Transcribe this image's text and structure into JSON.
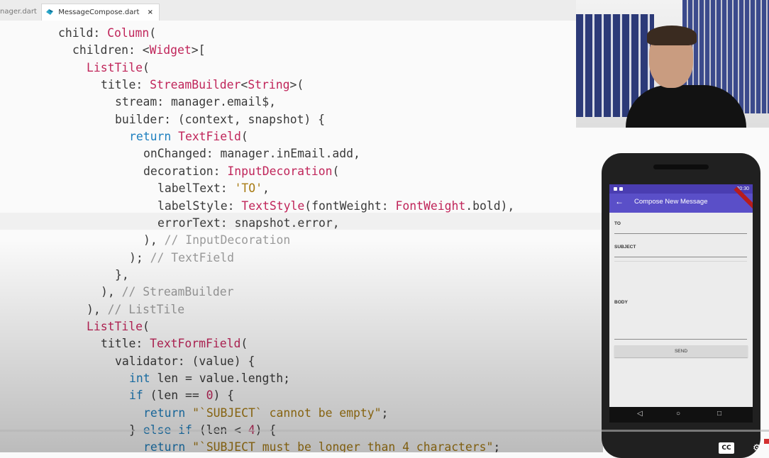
{
  "tabs": [
    {
      "label": "nager.dart",
      "active": false
    },
    {
      "label": "MessageCompose.dart",
      "active": true,
      "close": "×"
    }
  ],
  "code_lines": [
    {
      "indent": 0,
      "parts": [
        {
          "t": "child: ",
          "c": ""
        },
        {
          "t": "Column",
          "c": "t"
        },
        {
          "t": "(",
          "c": ""
        }
      ]
    },
    {
      "indent": 1,
      "parts": [
        {
          "t": "children: ",
          "c": ""
        },
        {
          "t": "<",
          "c": ""
        },
        {
          "t": "Widget",
          "c": "t"
        },
        {
          "t": ">[",
          "c": ""
        }
      ]
    },
    {
      "indent": 2,
      "parts": [
        {
          "t": "ListTile",
          "c": "t"
        },
        {
          "t": "(",
          "c": ""
        }
      ]
    },
    {
      "indent": 3,
      "parts": [
        {
          "t": "title: ",
          "c": ""
        },
        {
          "t": "StreamBuilder",
          "c": "t"
        },
        {
          "t": "<",
          "c": ""
        },
        {
          "t": "String",
          "c": "t"
        },
        {
          "t": ">(",
          "c": ""
        }
      ]
    },
    {
      "indent": 4,
      "parts": [
        {
          "t": "stream: manager.email$,",
          "c": ""
        }
      ]
    },
    {
      "indent": 4,
      "parts": [
        {
          "t": "builder: (context, snapshot) {",
          "c": ""
        }
      ]
    },
    {
      "indent": 5,
      "parts": [
        {
          "t": "return ",
          "c": "k"
        },
        {
          "t": "TextField",
          "c": "t"
        },
        {
          "t": "(",
          "c": ""
        }
      ]
    },
    {
      "indent": 6,
      "parts": [
        {
          "t": "onChanged: manager.inEmail.add,",
          "c": ""
        }
      ]
    },
    {
      "indent": 6,
      "parts": [
        {
          "t": "decoration: ",
          "c": ""
        },
        {
          "t": "InputDecoration",
          "c": "t"
        },
        {
          "t": "(",
          "c": ""
        }
      ]
    },
    {
      "indent": 7,
      "parts": [
        {
          "t": "labelText: ",
          "c": ""
        },
        {
          "t": "'TO'",
          "c": "s"
        },
        {
          "t": ",",
          "c": ""
        }
      ]
    },
    {
      "indent": 7,
      "parts": [
        {
          "t": "labelStyle: ",
          "c": ""
        },
        {
          "t": "TextStyle",
          "c": "t"
        },
        {
          "t": "(fontWeight: ",
          "c": ""
        },
        {
          "t": "FontWeight",
          "c": "t"
        },
        {
          "t": ".bold),",
          "c": ""
        }
      ]
    },
    {
      "indent": 7,
      "parts": [
        {
          "t": "errorText: snapshot.error,",
          "c": ""
        }
      ]
    },
    {
      "indent": 6,
      "parts": [
        {
          "t": "), ",
          "c": ""
        },
        {
          "t": "// InputDecoration",
          "c": "c"
        }
      ]
    },
    {
      "indent": 5,
      "parts": [
        {
          "t": "); ",
          "c": ""
        },
        {
          "t": "// TextField",
          "c": "c"
        }
      ]
    },
    {
      "indent": 4,
      "parts": [
        {
          "t": "},",
          "c": ""
        }
      ]
    },
    {
      "indent": 3,
      "parts": [
        {
          "t": "), ",
          "c": ""
        },
        {
          "t": "// StreamBuilder",
          "c": "c"
        }
      ]
    },
    {
      "indent": 2,
      "parts": [
        {
          "t": "), ",
          "c": ""
        },
        {
          "t": "// ListTile",
          "c": "c"
        }
      ]
    },
    {
      "indent": 2,
      "parts": [
        {
          "t": "ListTile",
          "c": "t"
        },
        {
          "t": "(",
          "c": ""
        }
      ]
    },
    {
      "indent": 3,
      "parts": [
        {
          "t": "title: ",
          "c": ""
        },
        {
          "t": "TextFormField",
          "c": "t"
        },
        {
          "t": "(",
          "c": ""
        }
      ]
    },
    {
      "indent": 4,
      "parts": [
        {
          "t": "validator: (value) {",
          "c": ""
        }
      ]
    },
    {
      "indent": 5,
      "parts": [
        {
          "t": "int ",
          "c": "k"
        },
        {
          "t": "len = value.length;",
          "c": ""
        }
      ]
    },
    {
      "indent": 5,
      "parts": [
        {
          "t": "if ",
          "c": "k"
        },
        {
          "t": "(len == ",
          "c": ""
        },
        {
          "t": "0",
          "c": "n"
        },
        {
          "t": ") {",
          "c": ""
        }
      ]
    },
    {
      "indent": 6,
      "parts": [
        {
          "t": "return ",
          "c": "k"
        },
        {
          "t": "\"`SUBJECT` cannot be empty\"",
          "c": "s"
        },
        {
          "t": ";",
          "c": ""
        }
      ]
    },
    {
      "indent": 5,
      "parts": [
        {
          "t": "} ",
          "c": ""
        },
        {
          "t": "else if ",
          "c": "k"
        },
        {
          "t": "(len < ",
          "c": ""
        },
        {
          "t": "4",
          "c": "n"
        },
        {
          "t": ") {",
          "c": ""
        }
      ]
    },
    {
      "indent": 6,
      "parts": [
        {
          "t": "return ",
          "c": "k"
        },
        {
          "t": "\"`SUBJECT must be longer than 4 characters\"",
          "c": "s"
        },
        {
          "t": ";",
          "c": ""
        }
      ]
    }
  ],
  "phone": {
    "status_time": "20:30",
    "app_title": "Compose New Message",
    "back_icon": "arrow-left-icon",
    "fields": [
      {
        "label": "TO"
      },
      {
        "label": "SUBJECT"
      },
      {
        "label": "BODY"
      }
    ],
    "send_label": "SEND",
    "nav": {
      "back": "◁",
      "home": "○",
      "recent": "□"
    }
  },
  "player": {
    "cc_label": "CC"
  },
  "colors": {
    "keyword": "#1d7fbf",
    "type": "#c0255a",
    "comment": "#9a9a9a",
    "string": "#a87c14",
    "app_bar": "#5a4fc8",
    "status_bar": "#4a3db1"
  }
}
